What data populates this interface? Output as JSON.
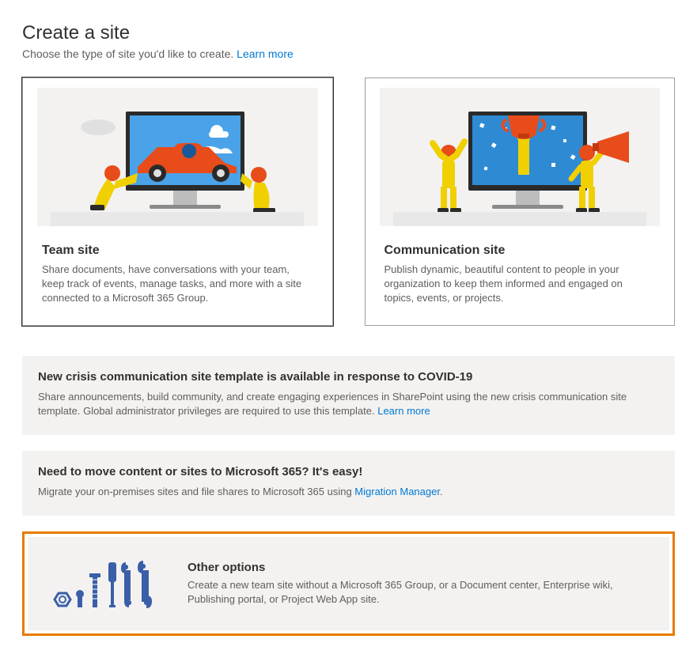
{
  "header": {
    "title": "Create a site",
    "subtitle_prefix": "Choose the type of site you'd like to create. ",
    "learn_more": "Learn more"
  },
  "cards": {
    "team": {
      "title": "Team site",
      "desc": "Share documents, have conversations with your team, keep track of events, manage tasks, and more with a site connected to a Microsoft 365 Group."
    },
    "communication": {
      "title": "Communication site",
      "desc": "Publish dynamic, beautiful content to people in your organization to keep them informed and engaged on topics, events, or projects."
    }
  },
  "banners": {
    "crisis": {
      "title": "New crisis communication site template is available in response to COVID-19",
      "desc_prefix": "Share announcements, build community, and create engaging experiences in SharePoint using the new crisis communication site template. Global administrator privileges are required to use this template. ",
      "link": "Learn more"
    },
    "migrate": {
      "title": "Need to move content or sites to Microsoft 365? It's easy!",
      "desc_prefix": "Migrate your on-premises sites and file shares to Microsoft 365 using ",
      "link": "Migration Manager",
      "suffix": "."
    }
  },
  "other": {
    "title": "Other options",
    "desc": "Create a new team site without a Microsoft 365 Group, or a Document center, Enterprise wiki, Publishing portal, or Project Web App site."
  }
}
